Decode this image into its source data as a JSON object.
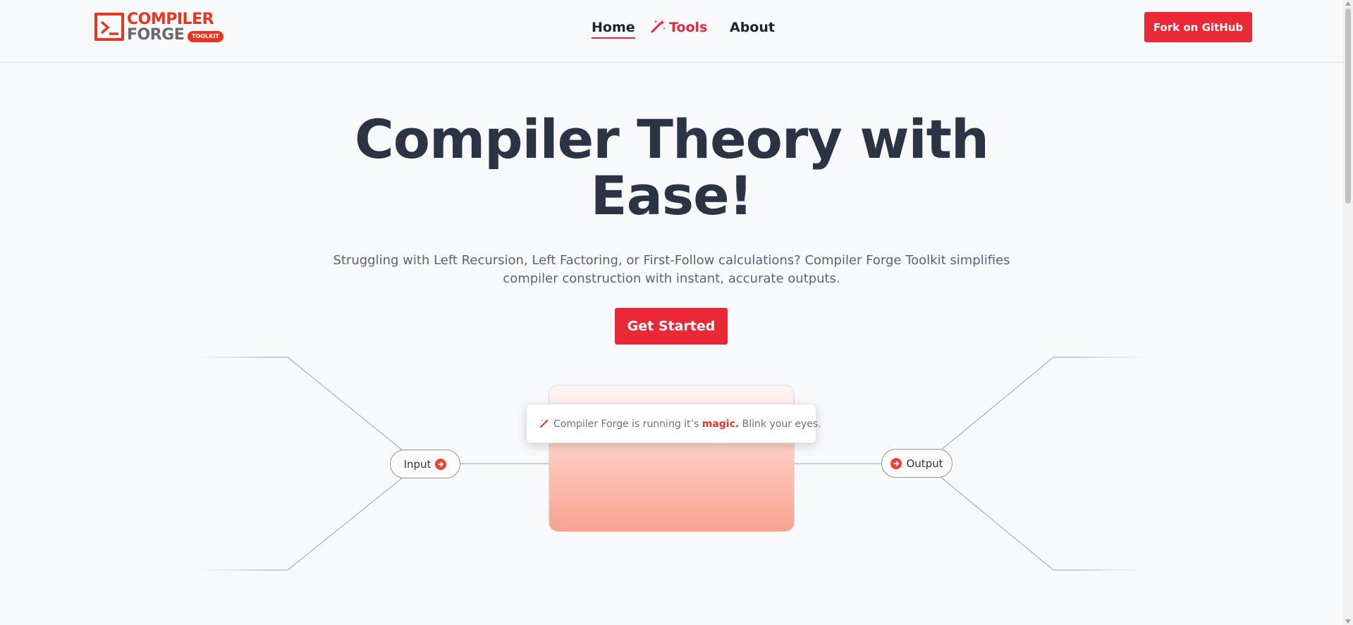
{
  "brand": {
    "word1": "COMPILER",
    "word2": "FORGE",
    "badge": "TOOLKIT",
    "accent_color": "#e8351f"
  },
  "nav": {
    "items": [
      {
        "label": "Home",
        "active": true
      },
      {
        "label": "Tools",
        "icon": "magic-wand-icon"
      },
      {
        "label": "About"
      }
    ],
    "cta_label": "Fork on GitHub"
  },
  "hero": {
    "title_line1": "Compiler Theory with",
    "title_line2": "Ease!",
    "subtitle_line1": "Struggling with Left Recursion, Left Factoring, or First-Follow calculations? Compiler Forge Toolkit simplifies",
    "subtitle_line2": "compiler construction with instant, accurate outputs.",
    "cta_label": "Get Started"
  },
  "diagram": {
    "input_label": "Input",
    "output_label": "Output",
    "toast_prefix": "Compiler Forge is running it’s ",
    "toast_emphasis": "magic.",
    "toast_suffix": " Blink your eyes."
  },
  "colors": {
    "primary_button": "#ea2836",
    "heading": "#2b3445",
    "body_text": "#5a6273"
  }
}
